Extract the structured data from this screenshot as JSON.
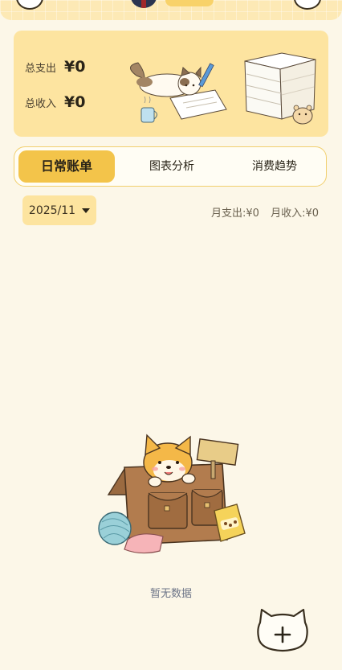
{
  "summary": {
    "expense_label": "总支出",
    "expense_value": "¥0",
    "income_label": "总收入",
    "income_value": "¥0"
  },
  "tabs": [
    {
      "label": "日常账单",
      "active": true
    },
    {
      "label": "图表分析",
      "active": false
    },
    {
      "label": "消费趋势",
      "active": false
    }
  ],
  "month": {
    "selected": "2025/11",
    "expense_text": "月支出:¥0",
    "income_text": "月收入:¥0"
  },
  "empty_state": {
    "text": "暂无数据"
  },
  "fab": {
    "icon": "plus-icon"
  },
  "colors": {
    "background": "#fcf7e8",
    "card": "#fde4a0",
    "accent": "#f3c44a"
  }
}
